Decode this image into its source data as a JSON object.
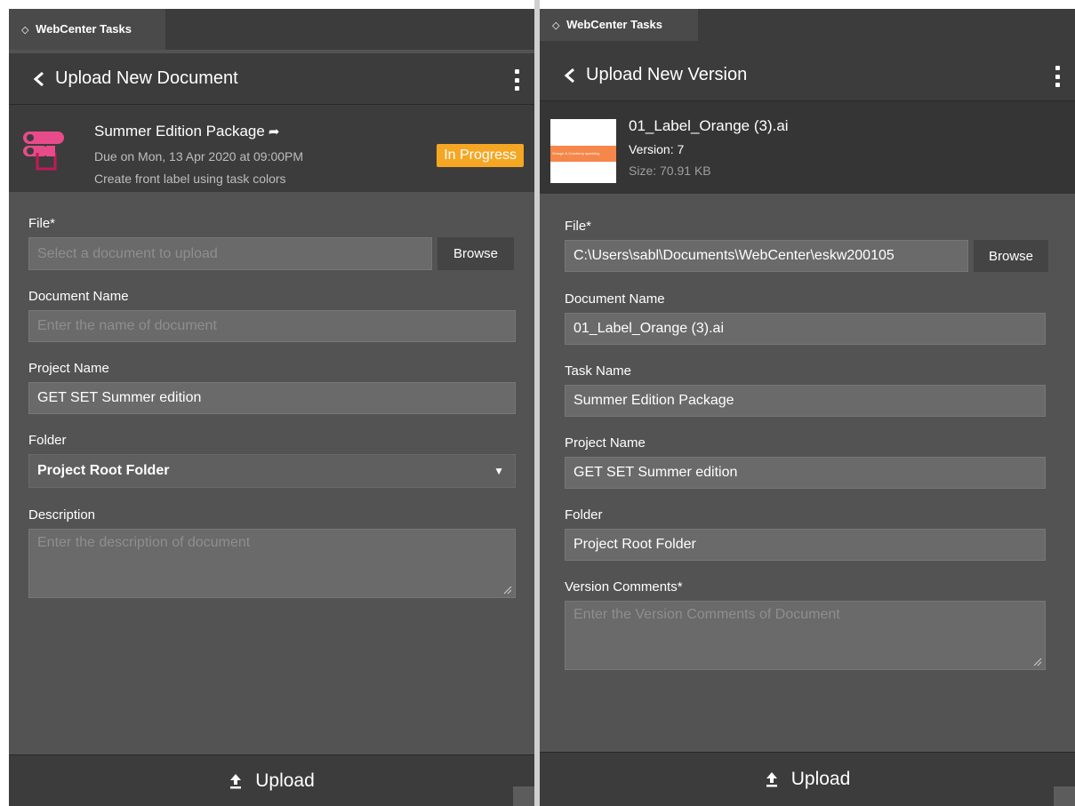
{
  "left_panel": {
    "tab_label": "WebCenter Tasks",
    "tab_glyph": "◇",
    "header_title": "Upload New Document",
    "task": {
      "title": "Summer Edition Package",
      "due": "Due on Mon, 13 Apr 2020 at 09:00PM",
      "description": "Create front label using task colors",
      "status": "In Progress"
    },
    "form": {
      "file_label": "File*",
      "file_placeholder": "Select a document to upload",
      "browse_label": "Browse",
      "document_name_label": "Document Name",
      "document_name_placeholder": "Enter the name of document",
      "project_name_label": "Project Name",
      "project_name_value": "GET SET Summer edition",
      "folder_label": "Folder",
      "folder_value": "Project Root Folder",
      "description_label": "Description",
      "description_placeholder": "Enter the description of document"
    },
    "upload_label": "Upload"
  },
  "right_panel": {
    "tab_label": "WebCenter Tasks",
    "tab_glyph": "◇",
    "header_title": "Upload New Version",
    "file_info": {
      "name": "01_Label_Orange (3).ai",
      "version": "Version: 7",
      "size": "Size: 70.91 KB",
      "thumb_text": "Orange & Cranberry sparkling"
    },
    "form": {
      "file_label": "File*",
      "file_value": "C:\\Users\\sabl\\Documents\\WebCenter\\eskw200105",
      "browse_label": "Browse",
      "document_name_label": "Document Name",
      "document_name_value": "01_Label_Orange (3).ai",
      "task_name_label": "Task Name",
      "task_name_value": "Summer Edition Package",
      "project_name_label": "Project Name",
      "project_name_value": "GET SET Summer edition",
      "folder_label": "Folder",
      "folder_value": "Project Root Folder",
      "version_comments_label": "Version Comments*",
      "version_comments_placeholder": "Enter the Version Comments of Document"
    },
    "upload_label": "Upload"
  },
  "colors": {
    "panel_bg": "#535353",
    "header_bg": "#3c3c3c",
    "input_bg": "#6a6a6a",
    "status_orange": "#f5a623",
    "task_icon_pink": "#e84b8a",
    "thumb_orange": "#f6874a"
  },
  "icons": {
    "back": "chevron-left-icon",
    "menu": "kebab-menu-icon",
    "share": "share-arrow-icon",
    "upload": "upload-icon",
    "dropdown": "caret-down-icon",
    "resize": "resize-grip-icon"
  }
}
